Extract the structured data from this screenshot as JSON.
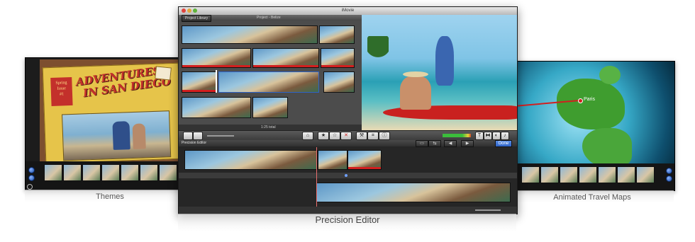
{
  "captions": {
    "themes": "Themes",
    "precision_editor": "Precision Editor",
    "travel_maps": "Animated Travel Maps"
  },
  "left_panel": {
    "title_line1": "Adventures",
    "title_line2": "In San Diego",
    "badge_line1": "Spring",
    "badge_line2": "Issue",
    "badge_line3": "#1"
  },
  "right_panel": {
    "map_label": "Paris"
  },
  "window": {
    "title": "iMovie",
    "project_library_button": "Project Library",
    "project_label": "Project - Belize",
    "total_time": "1:25 total",
    "precision_editor_label": "Precision Editor",
    "done_button": "Done"
  },
  "colors": {
    "accent_blue": "#2e63c7",
    "selection_red": "#d21f1f",
    "kayak_red": "#c9211f",
    "ocean": "#2aa0b5",
    "map_green": "#3f9d2f"
  }
}
